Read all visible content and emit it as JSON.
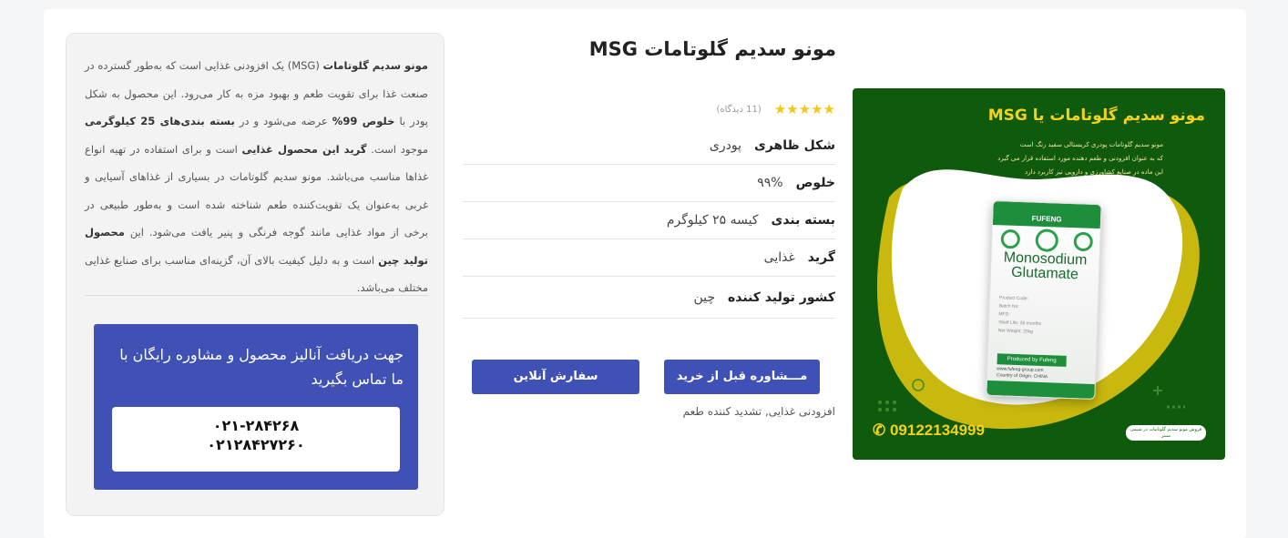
{
  "product": {
    "title": "مونو سدیم گلوتامات MSG",
    "rating": {
      "stars_display": "★★★★★",
      "stars": 5,
      "review_count_text": "(11 دیدگاه)"
    },
    "specs": [
      {
        "label": "شکل ظاهری",
        "value": "پودری"
      },
      {
        "label": "خلوص",
        "value": "۹۹%"
      },
      {
        "label": "بسته بندی",
        "value": "کیسه ۲۵ کیلوگرم"
      },
      {
        "label": "گرید",
        "value": "غذایی"
      },
      {
        "label": "کشور تولید کننده",
        "value": "چین"
      }
    ],
    "buttons": {
      "consult": "مـــشاوره قبل از خرید",
      "order": "سفارش آنلاین"
    },
    "tags": "افزودنی غذایی, تشدید کننده طعم"
  },
  "image": {
    "title": "مونو سدیم گلوتامات یا MSG",
    "desc_lines": [
      "مونو سدیم گلوتامات پودری کریستالی سفید رنگ است",
      "که به عنوان افزودنی و طعم دهنده مورد استفاده قرار می گیرد",
      "این ماده در صنایع کشاورزی و دارویی نیز کاربرد دارد"
    ],
    "phone": "09122134999",
    "badge": "فروش مونو سدیم گلوتامات در شیمی سنتز",
    "bag": {
      "brand": "FUFENG",
      "name_line1": "Monosodium",
      "name_line2": "Glutamate",
      "info_lines": [
        "Product Code:",
        "Batch No:",
        "MFD:",
        "Shelf Life: 36 months",
        "Net Weight: 25kg"
      ],
      "produced_by": "Produced by Fufeng",
      "website": "www.fufeng-group.com",
      "origin": "Country of Origin: CHINA"
    },
    "colors": {
      "background": "#0f5a0c",
      "accent": "#f4d21c",
      "blob_yellow": "#c9b80e"
    }
  },
  "description": {
    "p1_a": "مونو سدیم گلوتامات",
    "p1_b": " (MSG) یک افزودنی غذایی است که به‌طور گسترده در صنعت غذا برای تقویت طعم و بهبود مزه به کار می‌رود. این محصول به شکل پودر با ",
    "p1_c": "خلوص 99%",
    "p1_d": " عرضه می‌شود و در ",
    "p1_e": "بسته بندی‌های 25 کیلوگرمی",
    "p1_f": " موجود است. ",
    "p1_g": "گرید این محصول غذایی",
    "p1_h": " است و برای استفاده در تهیه انواع غذاها مناسب می‌باشد. مونو سدیم گلوتامات در بسیاری از غذاهای آسیایی و غربی به‌عنوان یک تقویت‌کننده طعم شناخته شده است و به‌طور طبیعی در برخی از مواد غذایی مانند گوجه فرنگی و پنیر یافت می‌شود. این ",
    "p1_i": "محصول تولید چین",
    "p1_j": " است و به دلیل کیفیت بالای آن، گزینه‌ای مناسب برای صنایع غذایی مختلف می‌باشد."
  },
  "contact": {
    "heading": "جهت دریافت آنالیز محصول و مشاوره رایگان با ما تماس بگیرید",
    "phone1": "۰۲۱-۲۸۴۲۶۸",
    "phone2": "۰۲۱۲۸۴۲۷۲۶۰"
  },
  "colors": {
    "primary": "#3f51b5",
    "star": "#f5c518"
  }
}
